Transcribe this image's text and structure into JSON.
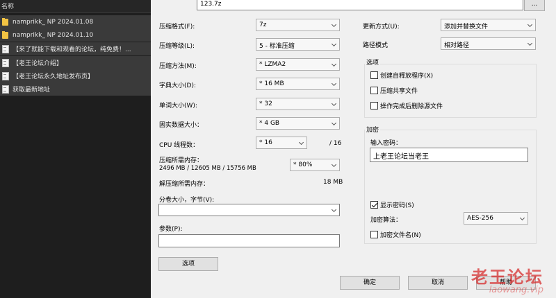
{
  "filepane": {
    "header": "名称",
    "items": [
      {
        "label": "namprikk_ NP 2024.01.08",
        "icon": "folder-icon"
      },
      {
        "label": "namprikk_ NP 2024.01.10",
        "icon": "folder-icon"
      },
      {
        "label": "【来了就能下载和观看的论坛，纯免费！...",
        "icon": "document-icon"
      },
      {
        "label": "【老王论坛介绍】",
        "icon": "document-icon"
      },
      {
        "label": "【老王论坛永久地址发布页】",
        "icon": "document-icon"
      },
      {
        "label": "获取最新地址",
        "icon": "document-icon"
      }
    ]
  },
  "archive": {
    "filename": "123.7z",
    "browse_label": "..."
  },
  "left": {
    "format_label": "压缩格式(F):",
    "format_value": "7z",
    "level_label": "压缩等级(L):",
    "level_value": "5 - 标准压缩",
    "method_label": "压缩方法(M):",
    "method_value": "* LZMA2",
    "dict_label": "字典大小(D):",
    "dict_value": "* 16 MB",
    "word_label": "单词大小(W):",
    "word_value": "* 32",
    "solid_label": "固实数据大小：",
    "solid_value": "* 4 GB",
    "cpu_label": "CPU 线程数：",
    "cpu_value": "* 16",
    "cpu_total": "/ 16",
    "mem_label": "压缩所需内存：",
    "mem_detail": "2496 MB / 12605 MB / 15756 MB",
    "mem_value": "* 80%",
    "decomp_label": "解压缩所需内存：",
    "decomp_value": "18 MB",
    "volume_label": "分卷大小，字节(V):",
    "volume_value": "",
    "params_label": "参数(P):",
    "params_value": "",
    "options_button": "选项"
  },
  "right": {
    "update_label": "更新方式(U):",
    "update_value": "添加并替换文件",
    "path_label": "路径模式",
    "path_value": "相对路径",
    "options_title": "选项",
    "opt_sfx": "创建自释放程序(X)",
    "opt_shared": "压缩共享文件",
    "opt_delete": "操作完成后删除源文件",
    "encrypt_title": "加密",
    "password_label": "输入密码：",
    "password_value": "上老王论坛当老王",
    "show_password": "显示密码(S)",
    "algo_label": "加密算法：",
    "algo_value": "AES-256",
    "encrypt_names": "加密文件名(N)"
  },
  "buttons": {
    "ok": "确定",
    "cancel": "取消",
    "help": "帮助"
  },
  "watermark": {
    "text": "老王论坛",
    "url": "laowang.vip"
  },
  "colors": {
    "dialog_bg": "#f0f0f0",
    "pane_bg": "#1e1e1e",
    "watermark": "#d62828"
  }
}
